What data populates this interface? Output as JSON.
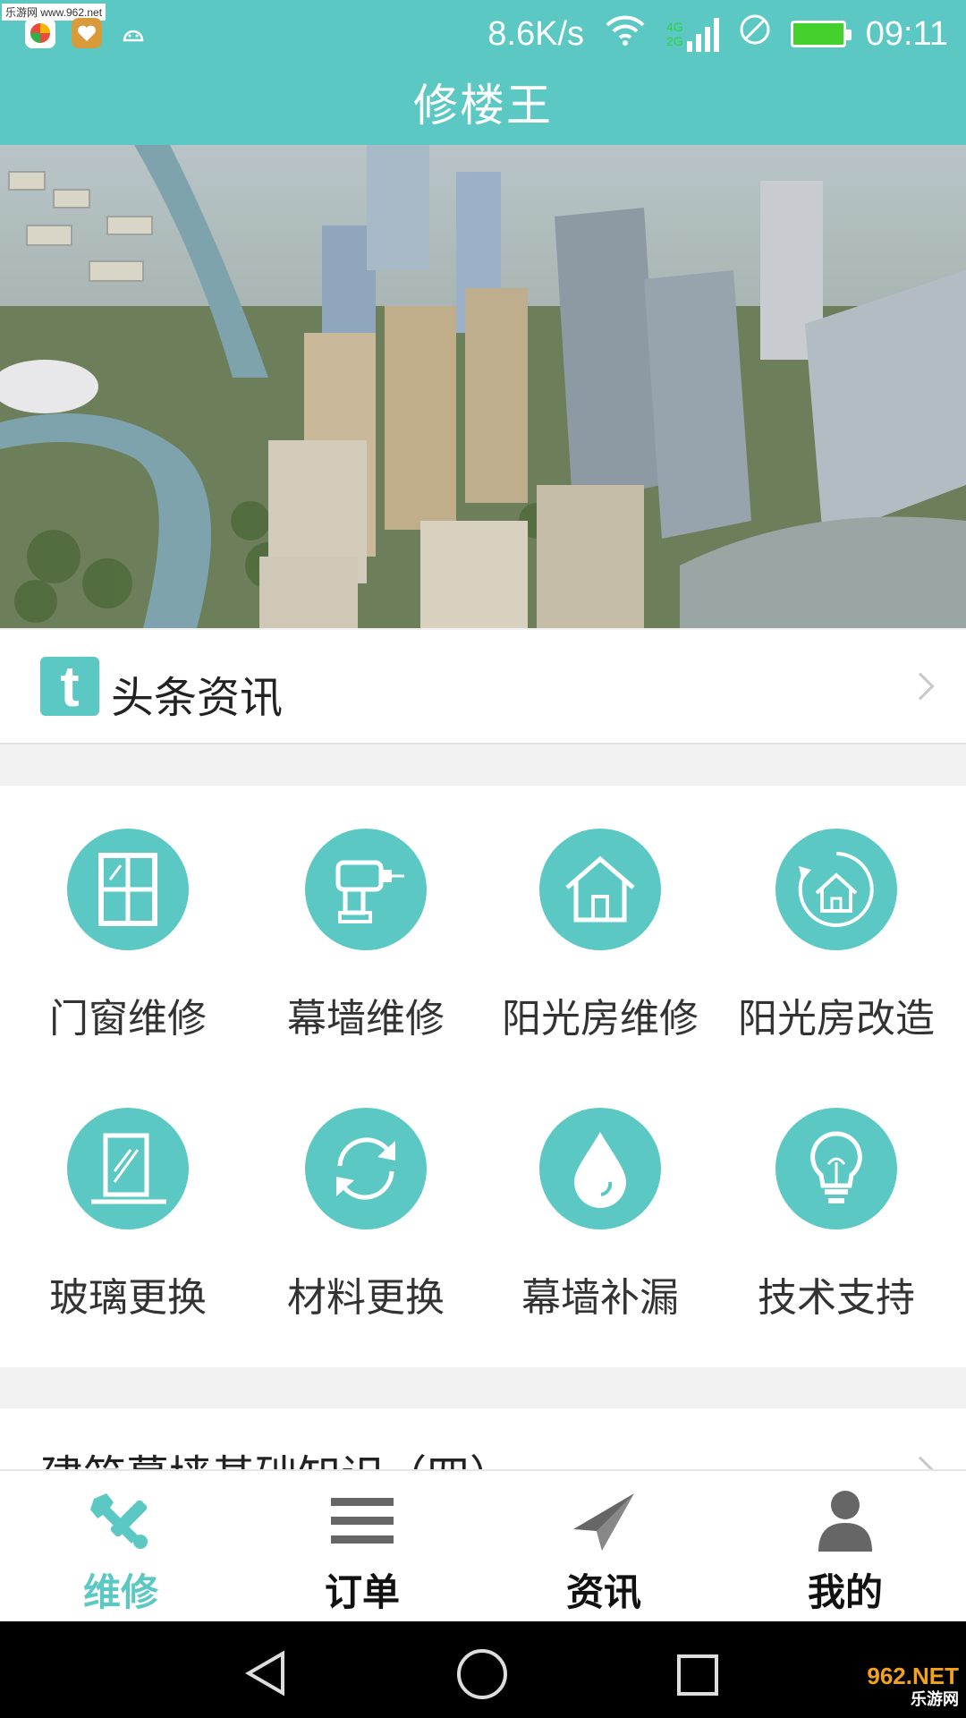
{
  "watermark_top": "乐游网 www.962.net",
  "status": {
    "speed": "8.6K/s",
    "network_top": "4G",
    "network_bottom": "2G",
    "time": "09:11"
  },
  "app_title": "修楼王",
  "headline": {
    "label": "头条资讯",
    "logo_letter": "t"
  },
  "services": [
    {
      "label": "门窗维修",
      "icon": "window-icon"
    },
    {
      "label": "幕墙维修",
      "icon": "drill-icon"
    },
    {
      "label": "阳光房维修",
      "icon": "house-icon"
    },
    {
      "label": "阳光房改造",
      "icon": "house-refresh-icon"
    },
    {
      "label": "玻璃更换",
      "icon": "glass-pane-icon"
    },
    {
      "label": "材料更换",
      "icon": "refresh-icon"
    },
    {
      "label": "幕墙补漏",
      "icon": "water-drop-icon"
    },
    {
      "label": "技术支持",
      "icon": "lightbulb-icon"
    }
  ],
  "article": {
    "title": "建筑幕墙基础知识（四）"
  },
  "nav": [
    {
      "label": "维修",
      "icon": "wrench-icon",
      "active": true
    },
    {
      "label": "订单",
      "icon": "list-icon",
      "active": false
    },
    {
      "label": "资讯",
      "icon": "paper-plane-icon",
      "active": false
    },
    {
      "label": "我的",
      "icon": "person-icon",
      "active": false
    }
  ],
  "watermark_bottom": {
    "line1": "962.NET",
    "line2": "乐游网"
  },
  "colors": {
    "accent": "#5cc8c3",
    "text": "#333333"
  }
}
